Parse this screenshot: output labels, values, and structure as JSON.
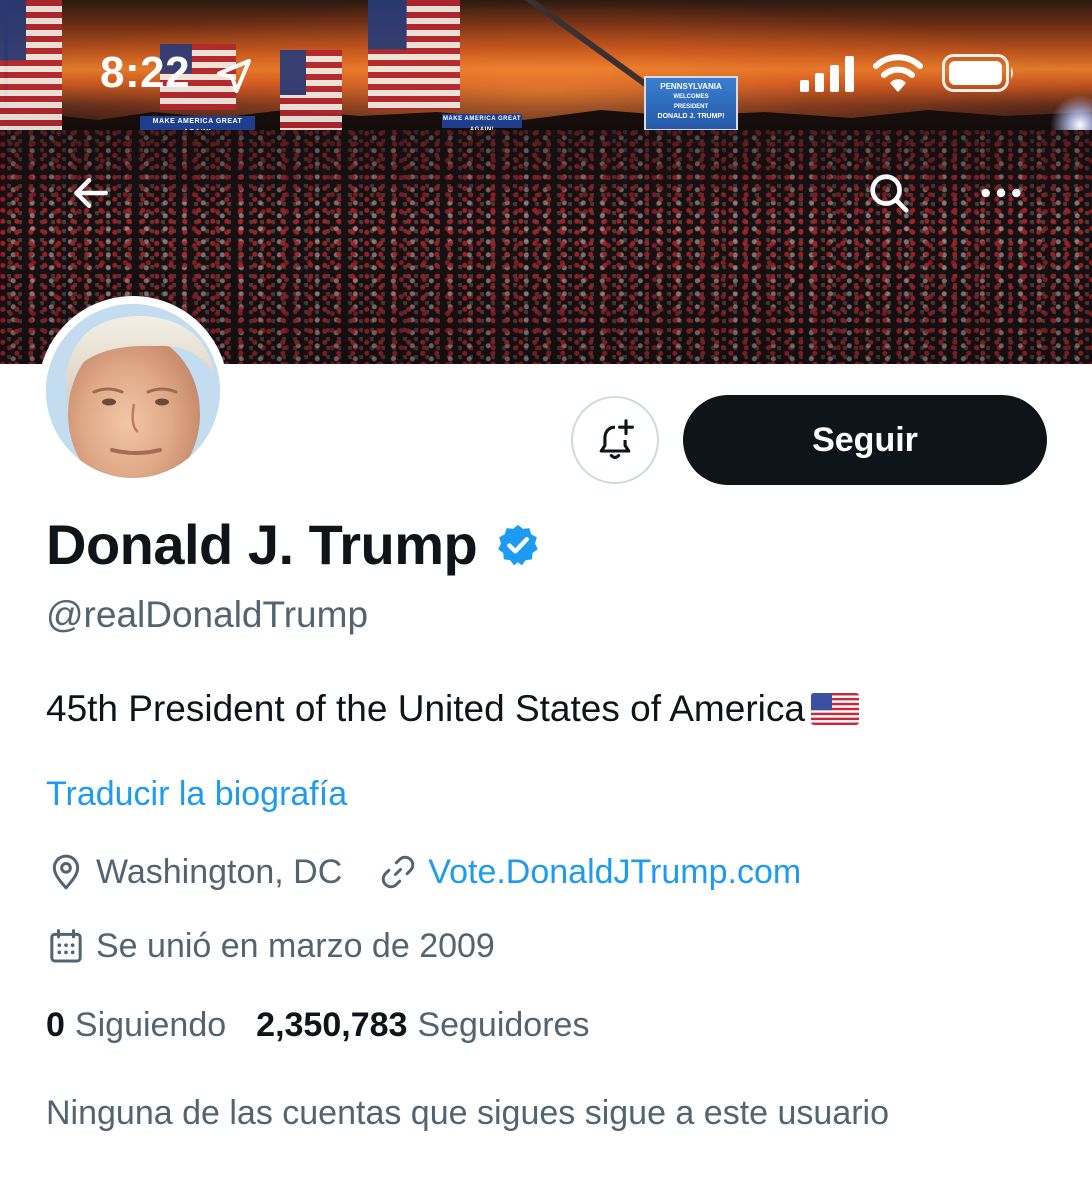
{
  "status_bar": {
    "time": "8:22"
  },
  "banner": {
    "signs": [
      "MAKE AMERICA GREAT AGAIN!",
      "MAKE AMERICA GREAT AGAIN!"
    ],
    "screen_lines": [
      "PENNSYLVANIA",
      "WELCOMES",
      "PRESIDENT",
      "DONALD J. TRUMP!"
    ]
  },
  "nav": {
    "back_icon": "arrow-left-icon",
    "search_icon": "search-icon",
    "more_icon": "more-horizontal-icon"
  },
  "profile": {
    "display_name": "Donald J. Trump",
    "handle": "@realDonaldTrump",
    "bio": "45th President of the United States of America",
    "bio_emoji": "us-flag-icon",
    "translate_label": "Traducir la biografía",
    "location": "Washington, DC",
    "website": "Vote.DonaldJTrump.com",
    "joined": "Se unió en marzo de 2009",
    "following_count": "0",
    "following_label": "Siguiendo",
    "followers_count": "2,350,783",
    "followers_label": "Seguidores",
    "mutual_note": "Ninguna de las cuentas que sigues sigue a este usuario"
  },
  "actions": {
    "follow_label": "Seguir",
    "notify_icon": "bell-plus-icon"
  },
  "colors": {
    "link": "#1d9bf0",
    "text_primary": "#0f1419",
    "text_secondary": "#536471",
    "button_dark": "#0f1419",
    "verified": "#1d9bf0"
  }
}
